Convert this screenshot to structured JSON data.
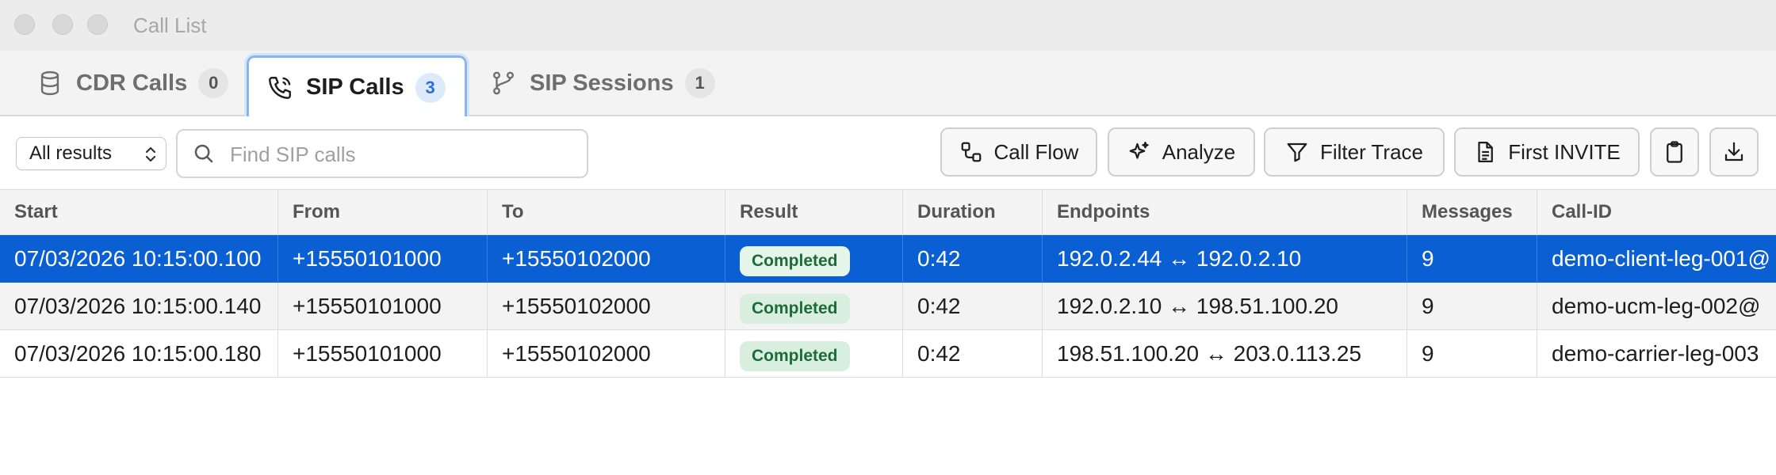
{
  "window": {
    "title": "Call List"
  },
  "tabs": [
    {
      "label": "CDR Calls",
      "count": "0",
      "icon": "database-icon"
    },
    {
      "label": "SIP Calls",
      "count": "3",
      "icon": "phone-icon"
    },
    {
      "label": "SIP Sessions",
      "count": "1",
      "icon": "branch-icon"
    }
  ],
  "toolbar": {
    "filter_value": "All results",
    "search_placeholder": "Find SIP calls",
    "buttons": {
      "call_flow": "Call Flow",
      "analyze": "Analyze",
      "filter_trace": "Filter Trace",
      "first_invite": "First INVITE"
    }
  },
  "table": {
    "columns": [
      "Start",
      "From",
      "To",
      "Result",
      "Duration",
      "Endpoints",
      "Messages",
      "Call-ID"
    ],
    "rows": [
      {
        "start": "07/03/2026 10:15:00.100",
        "from": "+15550101000",
        "to": "+15550102000",
        "result": "Completed",
        "duration": "0:42",
        "endpoints": "192.0.2.44 ↔ 192.0.2.10",
        "messages": "9",
        "call_id": "demo-client-leg-001@"
      },
      {
        "start": "07/03/2026 10:15:00.140",
        "from": "+15550101000",
        "to": "+15550102000",
        "result": "Completed",
        "duration": "0:42",
        "endpoints": "192.0.2.10 ↔ 198.51.100.20",
        "messages": "9",
        "call_id": "demo-ucm-leg-002@"
      },
      {
        "start": "07/03/2026 10:15:00.180",
        "from": "+15550101000",
        "to": "+15550102000",
        "result": "Completed",
        "duration": "0:42",
        "endpoints": "198.51.100.20 ↔ 203.0.113.25",
        "messages": "9",
        "call_id": "demo-carrier-leg-003"
      }
    ],
    "selected_row": 0
  },
  "colors": {
    "accent": "#0a5fd3",
    "status_bg": "#d8efdf",
    "status_text": "#1e6b3a"
  }
}
